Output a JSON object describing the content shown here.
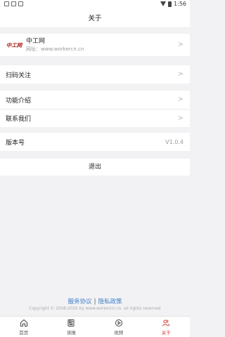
{
  "status_bar": {
    "time": "1:56"
  },
  "header": {
    "title": "关于"
  },
  "site": {
    "logo_text": "中工网",
    "name": "中工网",
    "url": "网址：www.workercn.cn"
  },
  "menu": {
    "scan_follow": "扫码关注",
    "features": "功能介绍",
    "contact": "联系我们",
    "version_label": "版本号",
    "version_value": "V1.0.4"
  },
  "logout": "退出",
  "footer": {
    "service": "服务协议",
    "separator": "|",
    "privacy": "隐私政策",
    "copyright": "Copyright © 2008-2020 by www.workercn.cn. all rights reserved"
  },
  "tabs": {
    "home": "首页",
    "read": "读报",
    "video": "视频",
    "about": "关于"
  },
  "colors": {
    "accent": "#d0403a",
    "link": "#3c7ec8"
  }
}
